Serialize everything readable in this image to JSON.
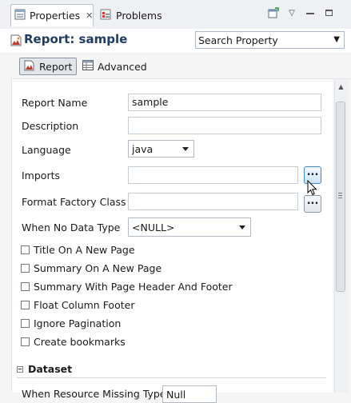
{
  "tabs": [
    {
      "label": "Properties",
      "active": true
    },
    {
      "label": "Problems",
      "active": false
    }
  ],
  "title": "Report: sample",
  "search": {
    "placeholder": "Search Property"
  },
  "page_tabs": [
    {
      "label": "Report",
      "active": true
    },
    {
      "label": "Advanced",
      "active": false
    }
  ],
  "fields": {
    "report_name": {
      "label": "Report Name",
      "value": "sample"
    },
    "description": {
      "label": "Description",
      "value": ""
    },
    "language": {
      "label": "Language",
      "value": "java"
    },
    "imports": {
      "label": "Imports",
      "value": "",
      "button": "..."
    },
    "format_factory": {
      "label": "Format Factory Class",
      "value": "",
      "button": "..."
    },
    "no_data": {
      "label": "When No Data Type",
      "value": "<NULL>"
    }
  },
  "checkboxes": [
    {
      "label": "Title On A New Page",
      "checked": false
    },
    {
      "label": "Summary On A New Page",
      "checked": false
    },
    {
      "label": "Summary With Page Header And Footer",
      "checked": false
    },
    {
      "label": "Float Column Footer",
      "checked": false
    },
    {
      "label": "Ignore Pagination",
      "checked": false
    },
    {
      "label": "Create bookmarks",
      "checked": false
    }
  ],
  "section": {
    "label": "Dataset"
  },
  "cut_row": {
    "label": "When Resource Missing Type",
    "value": "Null"
  },
  "icons": {
    "properties": "properties-icon",
    "problems": "problems-icon",
    "report": "report-icon",
    "advanced": "table-icon",
    "new_view": "new-view-icon",
    "view_menu": "chevron-down-icon",
    "minimize": "minimize-icon",
    "maximize": "maximize-icon"
  },
  "colors": {
    "title": "#1e3d63",
    "focus": "#3b8ad1"
  }
}
